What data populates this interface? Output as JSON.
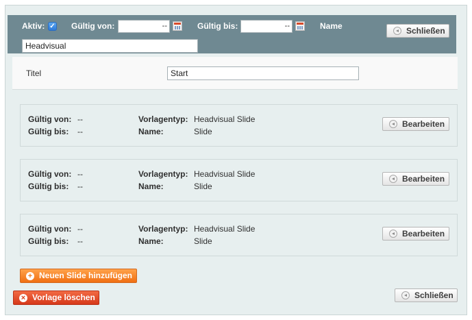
{
  "header": {
    "active_label": "Aktiv:",
    "active_checked": true,
    "valid_from_label": "Gültig von:",
    "valid_from_value": "--",
    "valid_to_label": "Gültig bis:",
    "valid_to_value": "--",
    "name_label": "Name",
    "name_value": "Headvisual",
    "close_label": "Schließen"
  },
  "title_row": {
    "label": "Titel",
    "value": "Start"
  },
  "slides": [
    {
      "valid_from_label": "Gültig von:",
      "valid_from": "--",
      "valid_to_label": "Gültig bis:",
      "valid_to": "--",
      "template_label": "Vorlagentyp:",
      "template": "Headvisual Slide",
      "name_label": "Name:",
      "name": "Slide",
      "edit_label": "Bearbeiten"
    },
    {
      "valid_from_label": "Gültig von:",
      "valid_from": "--",
      "valid_to_label": "Gültig bis:",
      "valid_to": "--",
      "template_label": "Vorlagentyp:",
      "template": "Headvisual Slide",
      "name_label": "Name:",
      "name": "Slide",
      "edit_label": "Bearbeiten"
    },
    {
      "valid_from_label": "Gültig von:",
      "valid_from": "--",
      "valid_to_label": "Gültig bis:",
      "valid_to": "--",
      "template_label": "Vorlagentyp:",
      "template": "Headvisual Slide",
      "name_label": "Name:",
      "name": "Slide",
      "edit_label": "Bearbeiten"
    }
  ],
  "footer": {
    "add_slide_label": "Neuen Slide hinzufügen",
    "delete_template_label": "Vorlage löschen",
    "close_label": "Schließen"
  },
  "colors": {
    "header_bg": "#6f8992",
    "panel_bg": "#e7efef",
    "orange_button": "#f27a1d",
    "red_button": "#d83f1d",
    "checkbox_blue": "#2d7ad8"
  },
  "icons": {
    "checkbox": "checkmark-icon",
    "date_picker": "calendar-icon",
    "close": "back-arrow-icon",
    "edit": "back-arrow-icon",
    "add": "plus-circle-icon",
    "delete": "x-circle-icon"
  }
}
